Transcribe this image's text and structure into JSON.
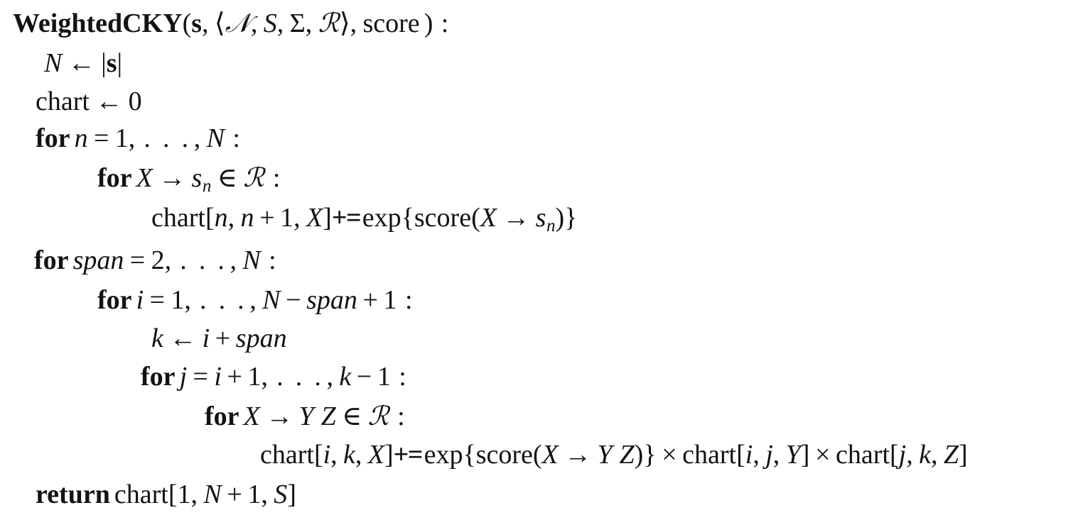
{
  "document": {
    "kind": "algorithm-pseudocode",
    "background_color": "#ffffff",
    "text_color": "#131313"
  },
  "algorithm": {
    "name": "WeightedCKY",
    "signature": {
      "keyword": "WeightedCKY",
      "open_paren": "(",
      "arg_sentence": "s",
      "comma1": ",",
      "grammar_open": "⟨",
      "grammar_nonterminals": "𝒩",
      "grammar_comma1": ",",
      "grammar_start": "S",
      "grammar_comma2": ",",
      "grammar_alphabet": "Σ",
      "grammar_comma3": ",",
      "grammar_rules": "ℛ",
      "grammar_close": "⟩",
      "comma2": ",",
      "arg_score": "score",
      "close_paren": ")",
      "colon": ":"
    },
    "lines": [
      {
        "id": "assign-N",
        "indent": 1,
        "text": "N ← |s|",
        "tokens": {
          "var": "N",
          "arrow": "←",
          "bar_open": "|",
          "sentence": "s",
          "bar_close": "|"
        }
      },
      {
        "id": "init-chart",
        "indent": 1,
        "text": "chart ← 0",
        "tokens": {
          "chart": "chart",
          "arrow": "←",
          "zero": "0"
        }
      },
      {
        "id": "for-n",
        "indent": 1,
        "text": "for n = 1, …, N :",
        "tokens": {
          "keyword": "for",
          "var": "n",
          "equals": "=",
          "start": "1",
          "comma": ",",
          "dots": ". . .",
          "comma2": ",",
          "end": "N",
          "colon": ":"
        }
      },
      {
        "id": "for-unary-rule",
        "indent": 3,
        "text": "for X → s_n ∈ ℛ :",
        "tokens": {
          "keyword": "for",
          "lhs": "X",
          "arrow": "→",
          "rhs": "s",
          "rhs_sub": "n",
          "in": "∈",
          "rules": "ℛ",
          "colon": ":"
        }
      },
      {
        "id": "update-chart-unary",
        "indent": 5,
        "text": "chart[n, n + 1, X] += exp{score(X → s_n)}",
        "tokens": {
          "chart": "chart",
          "open_bracket": "[",
          "i1": "n",
          "comma1": ",",
          "i2a": "n",
          "plus": "+",
          "i2b": "1",
          "comma2": ",",
          "i3": "X",
          "close_bracket": "]",
          "pluseq": "+=",
          "exp": "exp",
          "open_brace": "{",
          "score": "score",
          "open_paren": "(",
          "lhs": "X",
          "arrow": "→",
          "rhs": "s",
          "rhs_sub": "n",
          "close_paren": ")",
          "close_brace": "}"
        }
      },
      {
        "id": "for-span",
        "indent": 1,
        "text": "for span = 2, …, N :",
        "tokens": {
          "keyword": "for",
          "var": "span",
          "equals": "=",
          "start": "2",
          "comma": ",",
          "dots": ". . .",
          "comma2": ",",
          "end": "N",
          "colon": ":"
        }
      },
      {
        "id": "for-i",
        "indent": 3,
        "text": "for i = 1, …, N − span + 1 :",
        "tokens": {
          "keyword": "for",
          "var": "i",
          "equals": "=",
          "start": "1",
          "comma": ",",
          "dots": ". . .",
          "comma2": ",",
          "end_n": "N",
          "minus": "−",
          "end_span": "span",
          "plus": "+",
          "end_one": "1",
          "colon": ":"
        }
      },
      {
        "id": "assign-k",
        "indent": 4,
        "text": "k ← i + span",
        "tokens": {
          "var": "k",
          "arrow": "←",
          "i": "i",
          "plus": "+",
          "span": "span"
        }
      },
      {
        "id": "for-j",
        "indent": 5,
        "text": "for j = i + 1, …, k − 1 :",
        "tokens": {
          "keyword": "for",
          "var": "j",
          "equals": "=",
          "start_i": "i",
          "plus": "+",
          "start_one": "1",
          "comma": ",",
          "dots": ". . .",
          "comma2": ",",
          "end_k": "k",
          "minus": "−",
          "end_one": "1",
          "colon": ":"
        }
      },
      {
        "id": "for-binary-rule",
        "indent": 7,
        "text": "for X → Y Z ∈ ℛ :",
        "tokens": {
          "keyword": "for",
          "lhs": "X",
          "arrow": "→",
          "rhs_left": "Y",
          "rhs_right": "Z",
          "in": "∈",
          "rules": "ℛ",
          "colon": ":"
        }
      },
      {
        "id": "update-chart-binary",
        "indent": 9,
        "text": "chart[i, k, X] += exp{score(X → Y Z)} × chart[i, j, Y] × chart[j, k, Z]",
        "tokens": {
          "chart": "chart",
          "open_bracket": "[",
          "i1": "i",
          "comma1": ",",
          "i2": "k",
          "comma2": ",",
          "i3": "X",
          "close_bracket": "]",
          "pluseq": "+=",
          "exp": "exp",
          "open_brace": "{",
          "score": "score",
          "open_paren": "(",
          "lhs": "X",
          "arrow": "→",
          "rhs_left": "Y",
          "rhs_right": "Z",
          "close_paren": ")",
          "close_brace": "}",
          "times1": "×",
          "chart2": "chart",
          "c2_open": "[",
          "c2_i": "i",
          "c2_comma1": ",",
          "c2_j": "j",
          "c2_comma2": ",",
          "c2_sym": "Y",
          "c2_close": "]",
          "times2": "×",
          "chart3": "chart",
          "c3_open": "[",
          "c3_j": "j",
          "c3_comma1": ",",
          "c3_k": "k",
          "c3_comma2": ",",
          "c3_sym": "Z",
          "c3_close": "]"
        }
      },
      {
        "id": "return-chart",
        "indent": 1,
        "text": "return chart[1, N + 1, S]",
        "tokens": {
          "keyword": "return",
          "chart": "chart",
          "open_bracket": "[",
          "i1": "1",
          "comma1": ",",
          "i2a": "N",
          "plus": "+",
          "i2b": "1",
          "comma2": ",",
          "i3": "S",
          "close_bracket": "]"
        }
      }
    ]
  }
}
